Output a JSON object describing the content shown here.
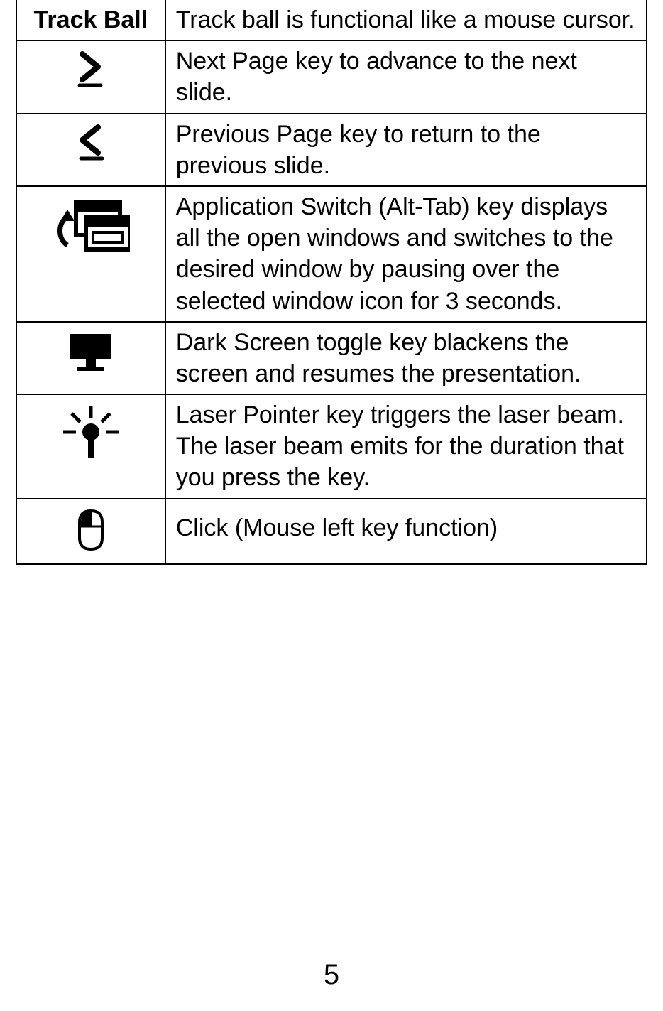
{
  "rows": [
    {
      "label": "Track Ball",
      "desc": "Track ball is functional like a mouse cursor."
    },
    {
      "label": "",
      "desc": "Next Page key to advance to the next slide."
    },
    {
      "label": "",
      "desc": "Previous Page key to return to the previous slide."
    },
    {
      "label": "",
      "desc": "Application Switch (Alt-Tab) key displays all the open windows and switches to the desired window by pausing over the selected window icon for 3 seconds."
    },
    {
      "label": "",
      "desc": "Dark Screen toggle key blackens the screen and resumes the presentation."
    },
    {
      "label": "",
      "desc": "Laser Pointer key triggers the laser beam. The laser beam emits for the duration that you press the key."
    },
    {
      "label": "",
      "desc": "Click (Mouse left key function)"
    }
  ],
  "page_number": "5"
}
